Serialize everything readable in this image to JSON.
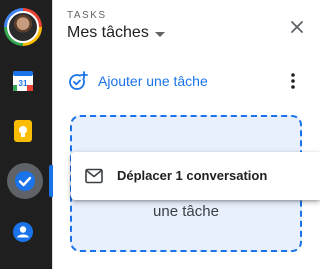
{
  "header": {
    "section_label": "TASKS",
    "list_title": "Mes tâches"
  },
  "actions": {
    "add_task_label": "Ajouter une tâche"
  },
  "drop_zone": {
    "text": "une tâche"
  },
  "drag_chip": {
    "label": "Déplacer 1 conversation"
  },
  "rail": {
    "apps": [
      "calendar-icon",
      "keep-icon",
      "tasks-icon",
      "contacts-icon"
    ],
    "active_app": "tasks-icon"
  },
  "colors": {
    "accent": "#1a73e8",
    "drop_zone_bg": "#e8f0fe",
    "rail_bg": "#1f1f1f"
  }
}
